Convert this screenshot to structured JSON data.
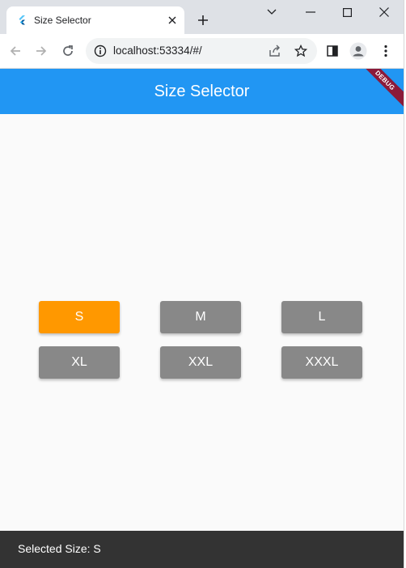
{
  "browser": {
    "tab_title": "Size Selector",
    "url": "localhost:53334/#/"
  },
  "app": {
    "title": "Size Selector",
    "debug_label": "DEBUG",
    "accent_color": "#2196f3",
    "selected_color": "#ff9800",
    "unselected_color": "#888888"
  },
  "sizes": [
    {
      "label": "S",
      "selected": true
    },
    {
      "label": "M",
      "selected": false
    },
    {
      "label": "L",
      "selected": false
    },
    {
      "label": "XL",
      "selected": false
    },
    {
      "label": "XXL",
      "selected": false
    },
    {
      "label": "XXXL",
      "selected": false
    }
  ],
  "status": {
    "label": "Selected Size: ",
    "value": "S"
  }
}
